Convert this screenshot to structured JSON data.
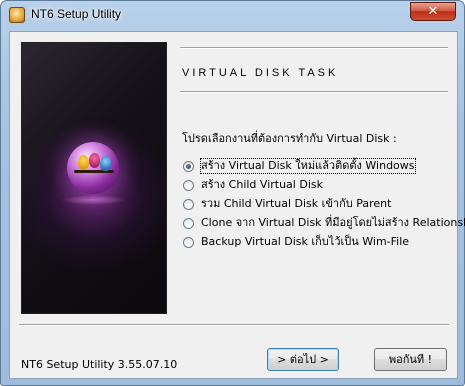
{
  "window": {
    "title": "NT6 Setup Utility",
    "close_glyph": "✕"
  },
  "header": {
    "task_title": "VIRTUAL DISK TASK"
  },
  "main": {
    "prompt": "โปรดเลือกงานที่ต้องการทำกับ Virtual Disk :",
    "options": [
      {
        "label": "สร้าง Virtual Disk ใหม่แล้วติดตั้ง Windows",
        "selected": true
      },
      {
        "label": "สร้าง Child Virtual Disk",
        "selected": false
      },
      {
        "label": "รวม Child Virtual Disk เข้ากับ Parent",
        "selected": false
      },
      {
        "label": "Clone จาก Virtual Disk ที่มีอยู่โดยไม่สร้าง Relationship",
        "selected": false
      },
      {
        "label": "Backup Virtual Disk เก็บไว้เป็น Wim-File",
        "selected": false
      }
    ]
  },
  "footer": {
    "version": "NT6 Setup Utility 3.55.07.10",
    "next_label": "> ต่อไป >",
    "cancel_label": "พอกันที !"
  },
  "icons": {
    "app": "setup-utility-icon",
    "close": "close-icon",
    "banner": "orb-birds-illustration"
  },
  "colors": {
    "titlebar": "#a6c3e2",
    "client_bg": "#f0f0f0",
    "close_button": "#c8402b",
    "default_button_border": "#3c7fb1"
  }
}
